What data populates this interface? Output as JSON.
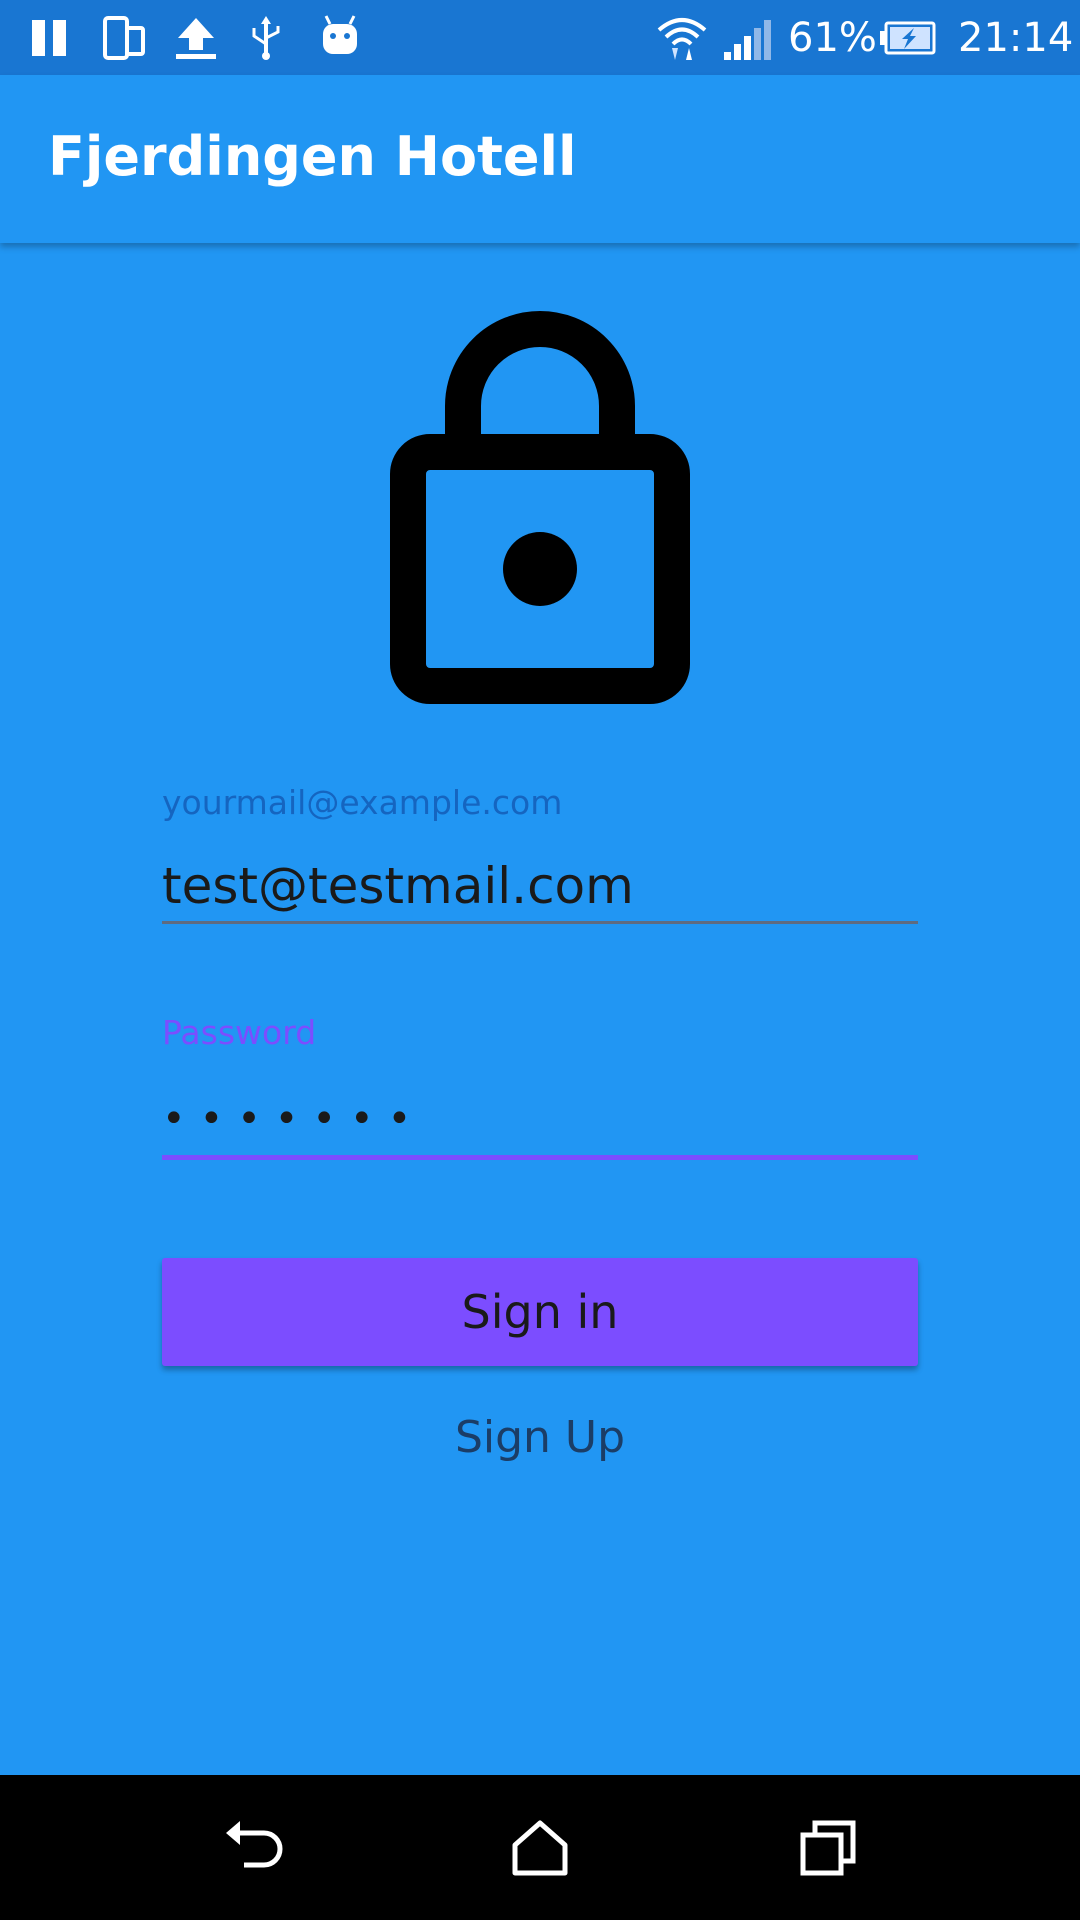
{
  "status_bar": {
    "battery_percent": "61%",
    "time": "21:14",
    "icons": [
      "pause-icon",
      "phone-rotate-icon",
      "upload-icon",
      "usb-icon",
      "android-icon",
      "wifi-icon",
      "signal-icon",
      "battery-charging-icon"
    ]
  },
  "app_bar": {
    "title": "Fjerdingen Hotell"
  },
  "login": {
    "icon": "lock-icon",
    "email_label": "yourmail@example.com",
    "email_value": "test@testmail.com",
    "password_label": "Password",
    "password_value": "•••••••",
    "signin_label": "Sign in",
    "signup_label": "Sign Up"
  },
  "nav_bar": {
    "icons": [
      "back-icon",
      "home-icon",
      "recents-icon"
    ]
  },
  "colors": {
    "primary": "#2196F3",
    "status_bar": "#1976D2",
    "accent": "#7C4DFF",
    "nav_bar": "#000000"
  }
}
